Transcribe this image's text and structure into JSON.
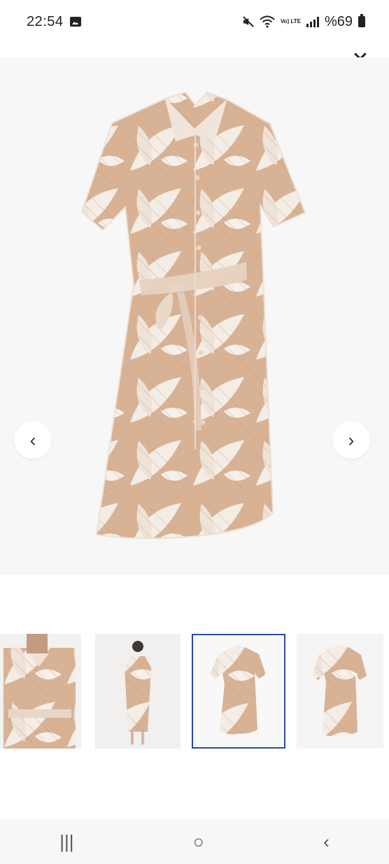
{
  "status": {
    "time": "22:54",
    "battery": "%69",
    "volte": "Vo) LTE"
  },
  "icons": {
    "close": "✕",
    "prev": "‹",
    "next": "›",
    "recents": "|||",
    "home": "○",
    "back": "‹"
  },
  "product": {
    "dress_pattern": [
      "#f1e9df",
      "#d4a98a",
      "#c9906b"
    ]
  },
  "thumbnails": [
    {
      "label": "model-front"
    },
    {
      "label": "model-back"
    },
    {
      "label": "flatlay-front",
      "active": true
    },
    {
      "label": "flatlay-back"
    }
  ],
  "colors": {
    "accent": "#2b4aa6",
    "dress_base": "#f0e6db",
    "dress_print": "#d7ad8f"
  }
}
